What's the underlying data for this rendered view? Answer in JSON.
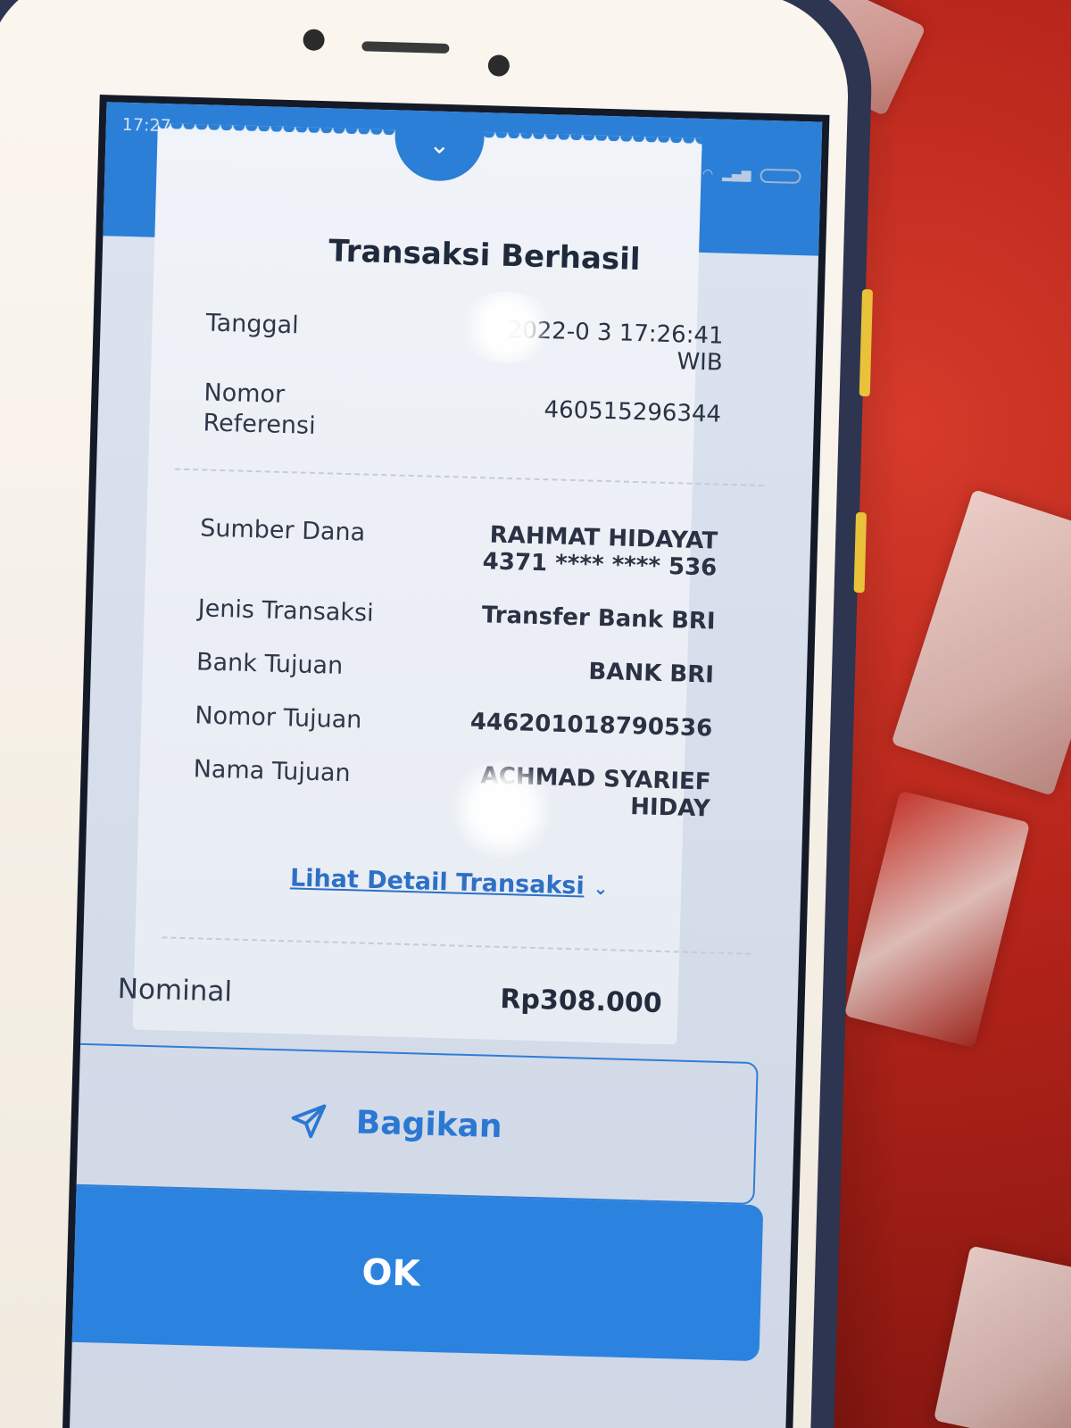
{
  "status_bar": {
    "time": "17:27"
  },
  "receipt": {
    "title": "Transaksi Berhasil",
    "tanggal": {
      "label": "Tanggal",
      "value_line1": "2022-0   3 17:26:41",
      "value_line2": "WIB"
    },
    "nomor_referensi": {
      "label_line1": "Nomor",
      "label_line2": "Referensi",
      "value": "460515296344"
    },
    "sumber_dana": {
      "label": "Sumber Dana",
      "name": "RAHMAT HIDAYAT",
      "account": "4371 **** **** 536"
    },
    "jenis_transaksi": {
      "label": "Jenis Transaksi",
      "value": "Transfer Bank BRI"
    },
    "bank_tujuan": {
      "label": "Bank Tujuan",
      "value": "BANK BRI"
    },
    "nomor_tujuan": {
      "label": "Nomor Tujuan",
      "value": "446201018790536"
    },
    "nama_tujuan": {
      "label": "Nama Tujuan",
      "value_line1": "ACHMAD SYARIEF",
      "value_line2": "HIDAY"
    },
    "detail_link": "Lihat Detail Transaksi",
    "nominal": {
      "label": "Nominal",
      "value": "Rp308.000"
    }
  },
  "actions": {
    "share_label": "Bagikan",
    "ok_label": "OK"
  },
  "colors": {
    "brand_blue": "#2c83df",
    "link_blue": "#2d70c6"
  },
  "icons": {
    "share": "send-icon",
    "collapse": "chevron-down-icon"
  }
}
